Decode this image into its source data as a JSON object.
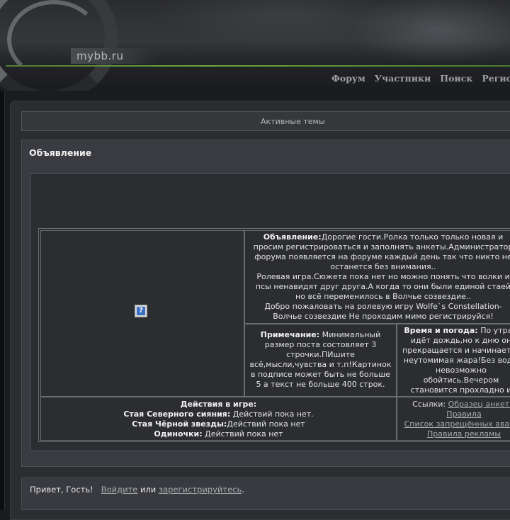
{
  "header": {
    "logo": "mybb.ru",
    "nav": [
      "Форум",
      "Участники",
      "Поиск",
      "Регистрация"
    ]
  },
  "active_topics": "Активные темы",
  "announcement": {
    "title": "Объявление",
    "cell1": {
      "label": "Объявление:",
      "text": "Дорогие гости.Ролка только только новая и просим регистрироваться и заполнять анкеты.Администратор форума появляется на форуме каждый день так что никто не останется без внимания..",
      "rp": "Ролевая игра.Сюжета пока нет но можно понять что волки и псы ненавидят друг друга.А когда то они были единой стаей но всё переменилось в Волчье созвездие..",
      "welcome": "Добро пожаловать на ролевую игру Wolfe`s Constellation-Волчье созвездие Не проходим мимо регистрируйся!"
    },
    "note": {
      "label": "Примечание:",
      "text": "Минимальный размер поста состовляет 3 строчки.ПИшите всё,мысли,чувства и т.п!Картинок в подписе может быть не больше 5 а текст не больше 400 строк."
    },
    "weather": {
      "label": "Время и погода:",
      "text": "По утрам идёт дождь,но к дню он прекращается и начинается неутомимая жара!Без воды невозможно обойтись.Вечером становится прохладно и ночью погода меняеться на прохладу."
    },
    "actions": {
      "title": "Действия в игре:",
      "rows": [
        {
          "label": "Стая Северного сияния:",
          "text": "Действий пока нет."
        },
        {
          "label": "Стая Чёрной звезды:",
          "text": "Действий пока нет"
        },
        {
          "label": "Одиночки:",
          "text": "Действий пока нет"
        }
      ]
    },
    "links": {
      "label": "Ссылки:",
      "items": [
        "Образец анкеты",
        "Правила",
        "Список запрещённых аватар",
        "Правила рекламы"
      ]
    }
  },
  "welcome": {
    "greeting": "Привет, Гость!",
    "login": "Войдите",
    "or": "или",
    "register": "зарегистрируйтесь",
    "end": "."
  }
}
